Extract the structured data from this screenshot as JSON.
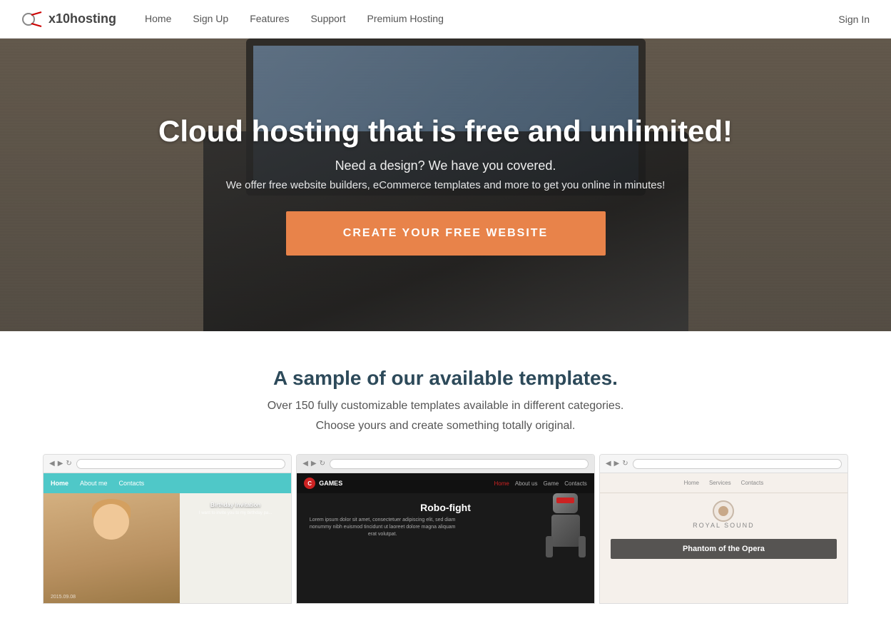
{
  "brand": {
    "name": "x10hosting",
    "logo_text": "x10hosting"
  },
  "nav": {
    "links": [
      {
        "label": "Home",
        "href": "#"
      },
      {
        "label": "Sign Up",
        "href": "#"
      },
      {
        "label": "Features",
        "href": "#"
      },
      {
        "label": "Support",
        "href": "#"
      },
      {
        "label": "Premium Hosting",
        "href": "#"
      }
    ],
    "signin": "Sign In"
  },
  "hero": {
    "title": "Cloud hosting that is free and unlimited!",
    "subtitle": "Need a design? We have you covered.",
    "description": "We offer free website builders, eCommerce templates and more to get you online in minutes!",
    "cta_label": "CREATE YOUR FREE WEBSITE"
  },
  "templates": {
    "title": "A sample of our available templates.",
    "subtitle": "Over 150 fully customizable templates available in different categories.",
    "sub2": "Choose yours and create something totally original."
  },
  "previews": [
    {
      "id": "birthday",
      "heading": "Birthday Invitation",
      "nav_items": [
        "Home",
        "About me",
        "Contacts"
      ],
      "text": "I want to invite you to my birthday pa...",
      "date": "2015.09.08"
    },
    {
      "id": "games",
      "logo_letter": "C",
      "logo_name": "GAMES",
      "nav_items": [
        "Home",
        "About us",
        "Game",
        "Contacts"
      ],
      "title": "Robo-fight",
      "desc": "Lorem ipsum dolor sit amet, consectetuer adipiscing elit, sed diam nonummy nibh euismod tincidunt ut laoreet dolore magna aliquam erat volutpat."
    },
    {
      "id": "royal",
      "nav_items": [
        "Home",
        "Services",
        "Contacts"
      ],
      "brand": "Royal sound",
      "title": "Phantom of the Opera",
      "subtitle": "of the Opera"
    }
  ],
  "colors": {
    "cta_orange": "#e8834a",
    "teal_nav": "#4fc8c8",
    "dark_header": "#2d4a5a"
  }
}
